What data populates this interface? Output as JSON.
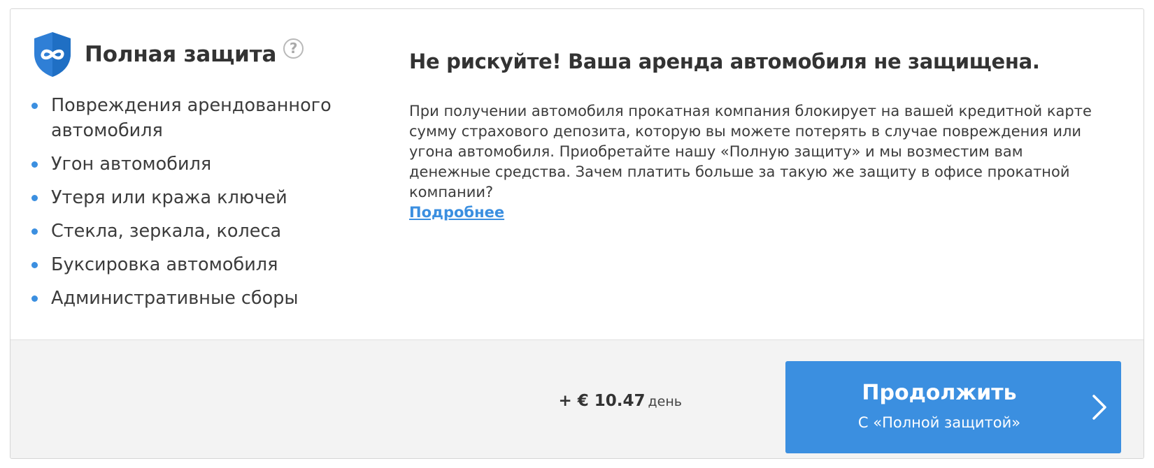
{
  "protection": {
    "title": "Полная защита",
    "help_icon": "?",
    "features": [
      "Повреждения арендованного автомобиля",
      "Угон автомобиля",
      "Утеря или кража ключей",
      "Стекла, зеркала, колеса",
      "Буксировка автомобиля",
      "Административные сборы"
    ]
  },
  "info": {
    "headline": "Не рискуйте! Ваша аренда автомобиля не защищена.",
    "description": "При получении автомобиля прокатная компания блокирует на вашей кредитной карте сумму страхового депозита, которую вы можете потерять в случае повреждения или угона автомобиля. Приобретайте нашу «Полную защиту» и мы возместим вам денежные средства. Зачем платить больше за такую же защиту в офисе прокатной компании?",
    "link": "Подробнее"
  },
  "footer": {
    "price": "+ € 10.47",
    "price_unit": "день",
    "button_title": "Продолжить",
    "button_subtitle": "С «Полной защитой»"
  },
  "colors": {
    "accent": "#3b8fe0",
    "shield": "#2f7fd6",
    "footer_bg": "#f3f3f3",
    "border": "#d6d6d6"
  },
  "icons": [
    "shield-icon",
    "infinity-icon",
    "help-icon",
    "bullet-icon",
    "chevron-right-icon"
  ]
}
